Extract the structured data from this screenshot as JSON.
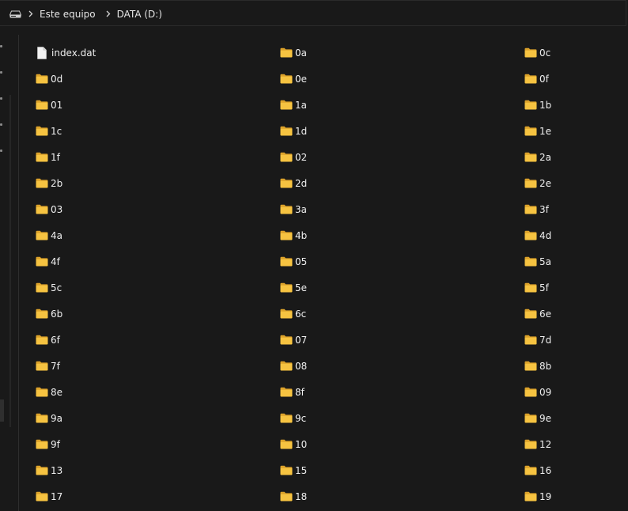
{
  "address_bar": {
    "icon": "drive-icon",
    "breadcrumbs": [
      "Este equipo",
      "DATA (D:)"
    ]
  },
  "colors": {
    "background": "#191919",
    "folder": "#f6c341",
    "folder_dark": "#dca22a",
    "file": "#f2f2f2"
  },
  "items": [
    {
      "name": "index.dat",
      "type": "file"
    },
    {
      "name": "0a",
      "type": "folder"
    },
    {
      "name": "0c",
      "type": "folder"
    },
    {
      "name": "0d",
      "type": "folder"
    },
    {
      "name": "0e",
      "type": "folder"
    },
    {
      "name": "0f",
      "type": "folder"
    },
    {
      "name": "01",
      "type": "folder"
    },
    {
      "name": "1a",
      "type": "folder"
    },
    {
      "name": "1b",
      "type": "folder"
    },
    {
      "name": "1c",
      "type": "folder"
    },
    {
      "name": "1d",
      "type": "folder"
    },
    {
      "name": "1e",
      "type": "folder"
    },
    {
      "name": "1f",
      "type": "folder"
    },
    {
      "name": "02",
      "type": "folder"
    },
    {
      "name": "2a",
      "type": "folder"
    },
    {
      "name": "2b",
      "type": "folder"
    },
    {
      "name": "2d",
      "type": "folder"
    },
    {
      "name": "2e",
      "type": "folder"
    },
    {
      "name": "03",
      "type": "folder"
    },
    {
      "name": "3a",
      "type": "folder"
    },
    {
      "name": "3f",
      "type": "folder"
    },
    {
      "name": "4a",
      "type": "folder"
    },
    {
      "name": "4b",
      "type": "folder"
    },
    {
      "name": "4d",
      "type": "folder"
    },
    {
      "name": "4f",
      "type": "folder"
    },
    {
      "name": "05",
      "type": "folder"
    },
    {
      "name": "5a",
      "type": "folder"
    },
    {
      "name": "5c",
      "type": "folder"
    },
    {
      "name": "5e",
      "type": "folder"
    },
    {
      "name": "5f",
      "type": "folder"
    },
    {
      "name": "6b",
      "type": "folder"
    },
    {
      "name": "6c",
      "type": "folder"
    },
    {
      "name": "6e",
      "type": "folder"
    },
    {
      "name": "6f",
      "type": "folder"
    },
    {
      "name": "07",
      "type": "folder"
    },
    {
      "name": "7d",
      "type": "folder"
    },
    {
      "name": "7f",
      "type": "folder"
    },
    {
      "name": "08",
      "type": "folder"
    },
    {
      "name": "8b",
      "type": "folder"
    },
    {
      "name": "8e",
      "type": "folder"
    },
    {
      "name": "8f",
      "type": "folder"
    },
    {
      "name": "09",
      "type": "folder"
    },
    {
      "name": "9a",
      "type": "folder"
    },
    {
      "name": "9c",
      "type": "folder"
    },
    {
      "name": "9e",
      "type": "folder"
    },
    {
      "name": "9f",
      "type": "folder"
    },
    {
      "name": "10",
      "type": "folder"
    },
    {
      "name": "12",
      "type": "folder"
    },
    {
      "name": "13",
      "type": "folder"
    },
    {
      "name": "15",
      "type": "folder"
    },
    {
      "name": "16",
      "type": "folder"
    },
    {
      "name": "17",
      "type": "folder"
    },
    {
      "name": "18",
      "type": "folder"
    },
    {
      "name": "19",
      "type": "folder"
    }
  ]
}
